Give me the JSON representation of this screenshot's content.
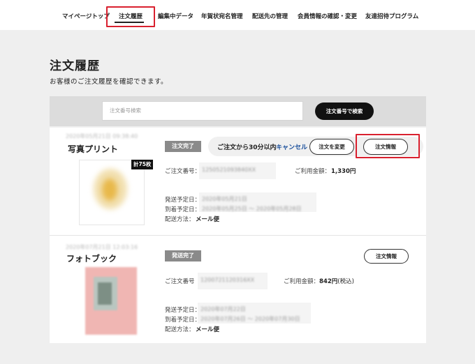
{
  "nav": {
    "items": [
      {
        "label": "マイページトップ"
      },
      {
        "label": "注文履歴"
      },
      {
        "label": "編集中データ"
      },
      {
        "label": "年賀状宛名管理"
      },
      {
        "label": "配送先の管理"
      },
      {
        "label": "会員情報の確認・変更"
      },
      {
        "label": "友達招待プログラム"
      }
    ],
    "active_index": 1
  },
  "page": {
    "title": "注文履歴",
    "description": "お客様のご注文履歴を確認できます。"
  },
  "search": {
    "placeholder": "注文番号検索",
    "button_label": "注文番号で検索"
  },
  "orders": [
    {
      "date": "2020年05月21日 09:38:40",
      "product_name": "写真プリント",
      "count_badge": "計75枚",
      "status": "注文完了",
      "notice": "ご注文から30分以内",
      "cancel_label": "キャンセル",
      "change_label": "注文を変更",
      "info_label": "注文情報",
      "order_no_label": "ご注文番号：",
      "order_no": "1250521093840XX",
      "amount_label": "ご利用金額：",
      "amount": "1,330円",
      "ship_date_label": "発送予定日：",
      "ship_date": "2020年05月21日",
      "arrival_label": "到着予定日：",
      "arrival_date": "2020年05月25日 ～ 2020年05月28日",
      "method_label": "配送方法：",
      "method": "メール便"
    },
    {
      "date": "2020年07月21日 12:03:16",
      "product_name": "フォトブック",
      "status": "発送完了",
      "info_label": "注文情報",
      "order_no_label": "ご注文番号",
      "order_no": "1200721120316XX",
      "amount_label": "ご利用金額：",
      "amount": "842円",
      "amount_suffix": "(税込)",
      "ship_date_label": "発送予定日：",
      "ship_date": "2020年07月22日",
      "arrival_label": "到着予定日：",
      "arrival_date": "2020年07月26日 ～ 2020年07月30日",
      "method_label": "配送方法：",
      "method": "メール便"
    }
  ],
  "colors": {
    "highlight": "#d9202e",
    "cancel_link": "#1a4f9c",
    "status_badge": "#8a8a8a",
    "search_button": "#111111"
  }
}
